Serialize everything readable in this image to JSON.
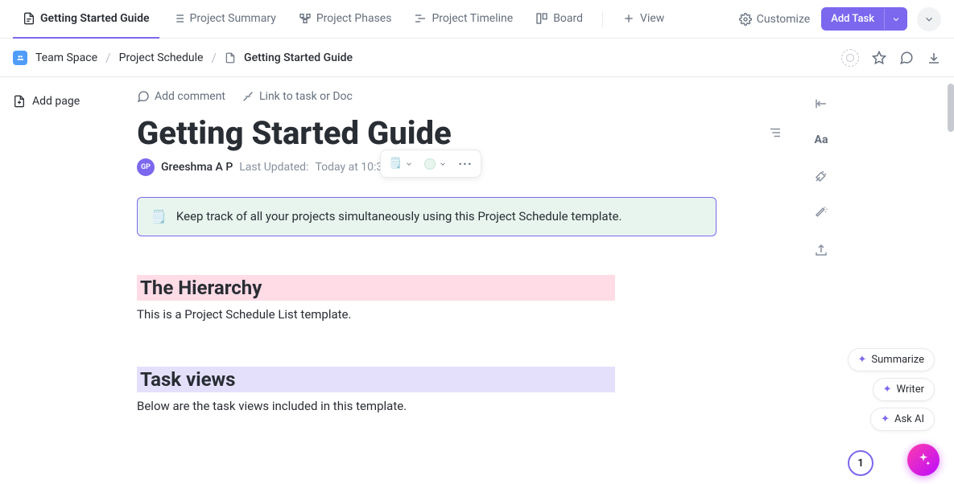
{
  "tabs": [
    {
      "label": "Getting Started Guide",
      "active": true
    },
    {
      "label": "Project Summary",
      "active": false
    },
    {
      "label": "Project Phases",
      "active": false
    },
    {
      "label": "Project Timeline",
      "active": false
    },
    {
      "label": "Board",
      "active": false
    }
  ],
  "view_button": "View",
  "customize": "Customize",
  "add_task": "Add Task",
  "breadcrumb": {
    "space": "Team Space",
    "list": "Project Schedule",
    "doc": "Getting Started Guide"
  },
  "sidebar": {
    "add_page": "Add page"
  },
  "doc": {
    "actions": {
      "comment": "Add comment",
      "link": "Link to task or Doc"
    },
    "title": "Getting Started Guide",
    "author_initials": "GP",
    "author": "Greeshma A P",
    "updated_label": "Last Updated:",
    "updated_value": "Today at 10:37 am",
    "callout_emoji": "🗒️",
    "callout_text": "Keep track of all your projects simultaneously using this Project Schedule template.",
    "h2_a": "The Hierarchy",
    "p_a": "This is a Project Schedule List template.",
    "h2_b": "Task views",
    "p_b": "Below are the task views included in this template."
  },
  "rail": {
    "aa": "Aa"
  },
  "ai": {
    "summarize": "Summarize",
    "writer": "Writer",
    "ask": "Ask AI"
  },
  "notif_count": "1",
  "floating_toolbar": {
    "swatch1_emoji": "🗒️",
    "swatch2_color": "#e7f5ee"
  }
}
